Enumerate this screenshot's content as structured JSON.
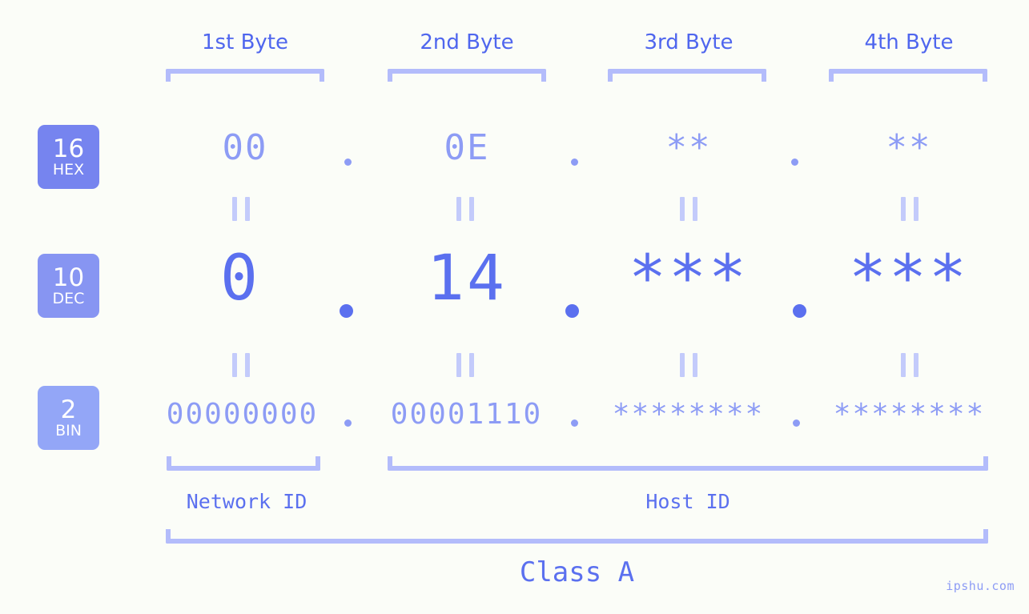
{
  "watermark": "ipshu.com",
  "byte_headers": [
    {
      "label": "1st Byte"
    },
    {
      "label": "2nd Byte"
    },
    {
      "label": "3rd Byte"
    },
    {
      "label": "4th Byte"
    }
  ],
  "bases": [
    {
      "number": "16",
      "name": "HEX",
      "color": "#7684ef"
    },
    {
      "number": "10",
      "name": "DEC",
      "color": "#8795f2"
    },
    {
      "number": "2",
      "name": "BIN",
      "color": "#93a6f7"
    }
  ],
  "rows": {
    "hex": {
      "base_number": "16",
      "base_name": "HEX",
      "values": [
        "00",
        "0E",
        "**",
        "**"
      ],
      "separator": "."
    },
    "dec": {
      "base_number": "10",
      "base_name": "DEC",
      "values": [
        "0",
        "14",
        "***",
        "***"
      ],
      "separator": "."
    },
    "bin": {
      "base_number": "2",
      "base_name": "BIN",
      "values": [
        "00000000",
        "00001110",
        "********",
        "********"
      ],
      "separator": "."
    }
  },
  "connectors": {
    "equals_symbol": "=",
    "count_per_gap": 4
  },
  "segments": {
    "network_id": "Network ID",
    "host_id": "Host ID"
  },
  "class_label": "Class A",
  "colors": {
    "background": "#fbfdf8",
    "accent_strong": "#4f66ee",
    "accent_mid": "#5b70ef",
    "accent_light": "#8d9cf5",
    "bracket": "#b3bcfb",
    "connector": "#c3cbfb"
  }
}
